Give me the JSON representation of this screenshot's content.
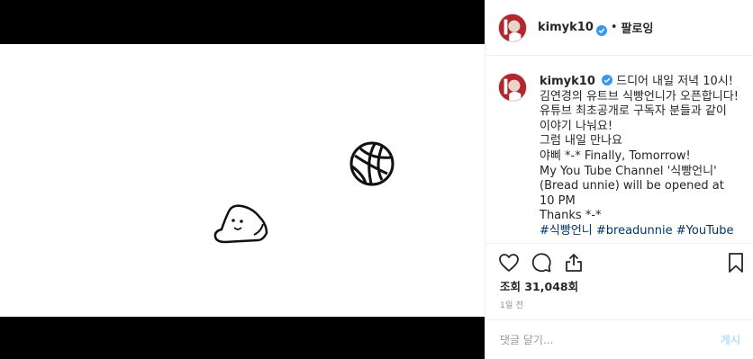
{
  "post": {
    "username": "kimyk10",
    "follow_label": "팔로잉",
    "dot": "•"
  },
  "caption": {
    "username": "kimyk10",
    "lines": [
      "드디어 내일 저녁 10시!",
      "김연경의 유트브 식빵언니가 오픈합니다!",
      "유튜브 최초공개로 구독자 분들과 같이 이야기 나눠요!",
      "그럼 내일 만나요",
      "야삐 *-* Finally, Tomorrow!",
      "My You Tube Channel '식빵언니'",
      "(Bread unnie) will be opened at 10 PM",
      "Thanks *-*"
    ],
    "hashtags": [
      "#식빵언니",
      "#breadunnie",
      "#YouTube"
    ]
  },
  "stats": {
    "views": "조회 31,048회",
    "time": "1일 전"
  },
  "comment": {
    "placeholder": "댓글 달기...",
    "post_label": "게시"
  },
  "icons": {
    "avatar": "profile-avatar-icon",
    "verified": "verified-badge-icon",
    "like": "heart-icon",
    "comment": "comment-bubble-icon",
    "share": "share-icon",
    "save": "bookmark-icon",
    "media_ball": "volleyball-icon",
    "media_bread": "bread-character-icon"
  },
  "colors": {
    "verified": "#3897f0",
    "hashtag": "#003569",
    "avatar_bg": "#b3262d"
  }
}
